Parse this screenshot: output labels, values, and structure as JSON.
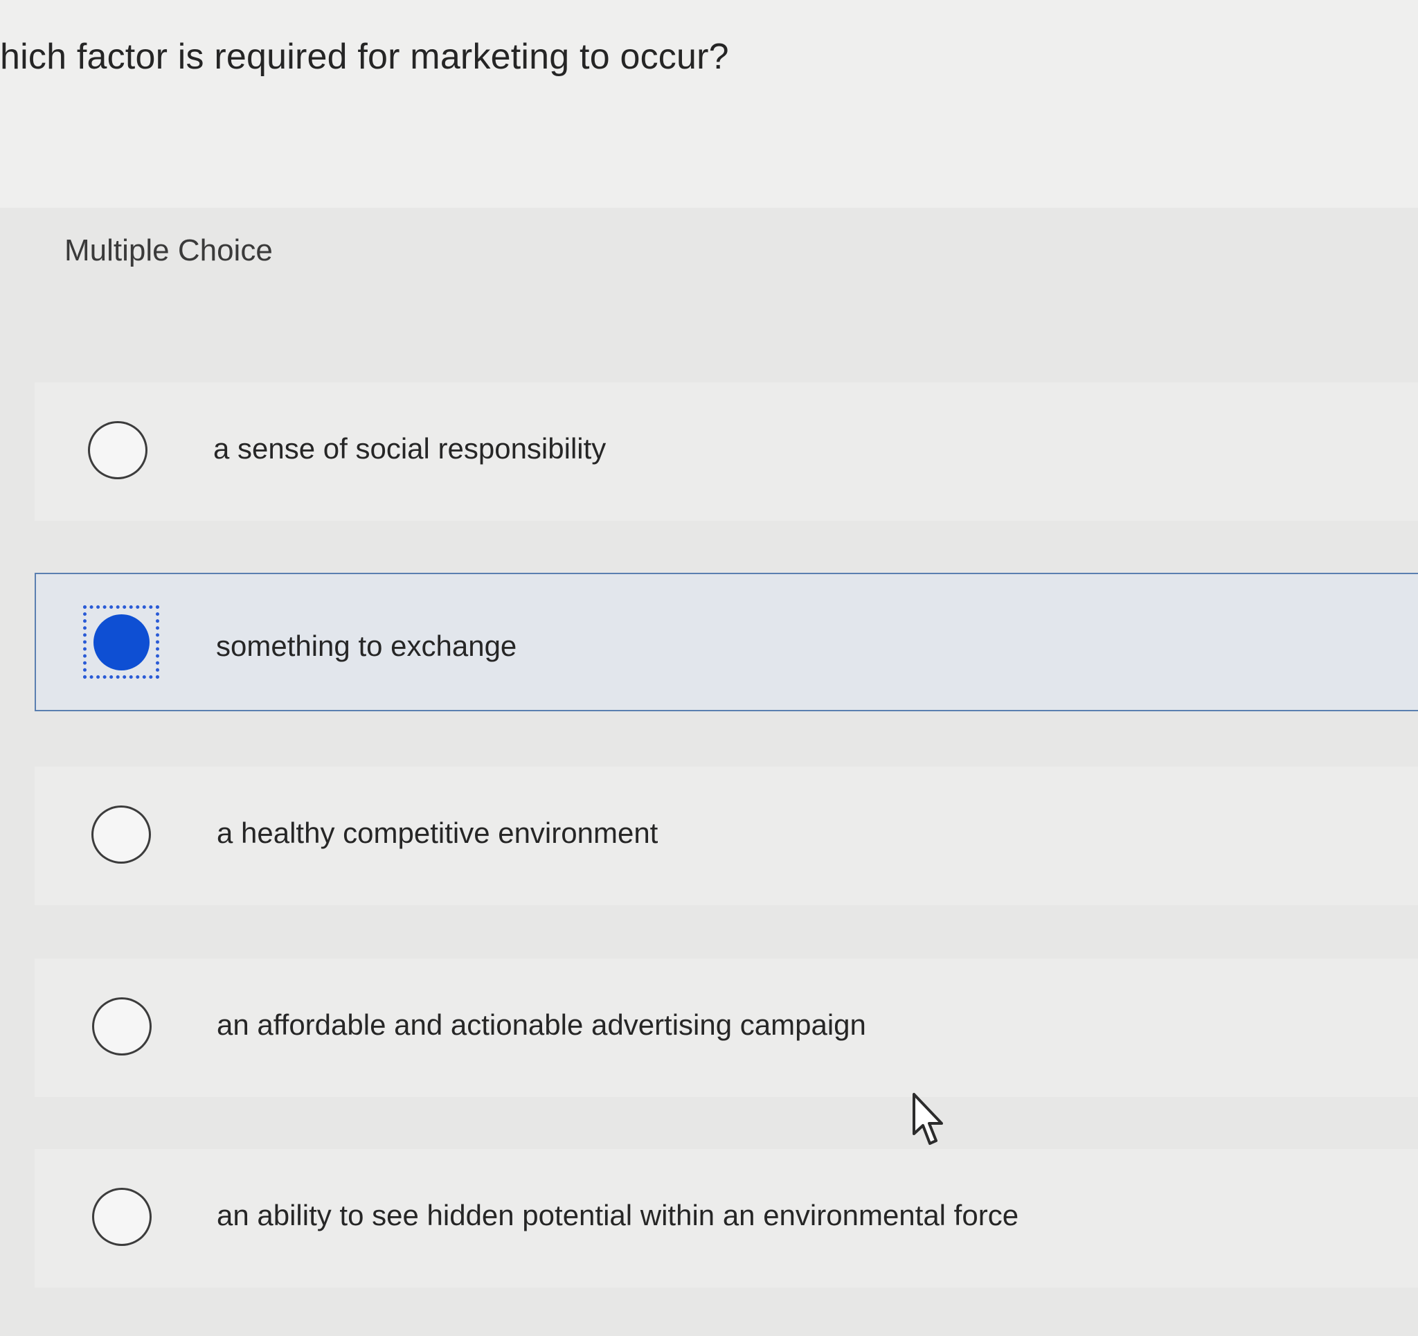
{
  "question": {
    "text": "hich factor is required for marketing to occur?"
  },
  "choice_type": "Multiple Choice",
  "options": [
    {
      "label": "a sense of social responsibility",
      "selected": false
    },
    {
      "label": "something to exchange",
      "selected": true
    },
    {
      "label": "a healthy competitive environment",
      "selected": false
    },
    {
      "label": "an affordable and actionable advertising campaign",
      "selected": false
    },
    {
      "label": "an ability to see hidden potential within an environmental force",
      "selected": false
    }
  ],
  "colors": {
    "selected_fill": "#0e4fd3",
    "selected_row_border": "#5a7fb0",
    "selected_row_background": "#e2e6ec"
  },
  "icons": {
    "cursor": "pointer-arrow-icon"
  }
}
